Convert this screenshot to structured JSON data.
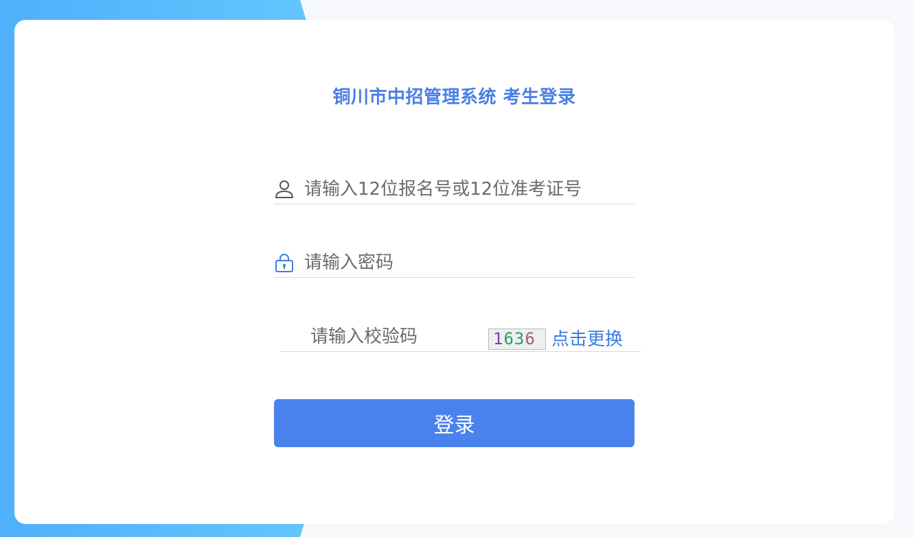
{
  "colors": {
    "accent": "#4a7fe6",
    "button": "#4a82ed",
    "link": "#3c7de0",
    "background_gradient_start": "#4fb0fb",
    "background_gradient_end": "#63c6fd"
  },
  "title": "铜川市中招管理系统 考生登录",
  "form": {
    "username": {
      "icon": "user-icon",
      "placeholder": "请输入12位报名号或12位准考证号",
      "value": ""
    },
    "password": {
      "icon": "lock-icon",
      "placeholder": "请输入密码",
      "value": ""
    },
    "captcha": {
      "placeholder": "请输入校验码",
      "value": "",
      "image_text": "1636",
      "image_digits": [
        "1",
        "6",
        "3",
        "6"
      ],
      "refresh_label": "点击更换"
    },
    "submit_label": "登录"
  }
}
